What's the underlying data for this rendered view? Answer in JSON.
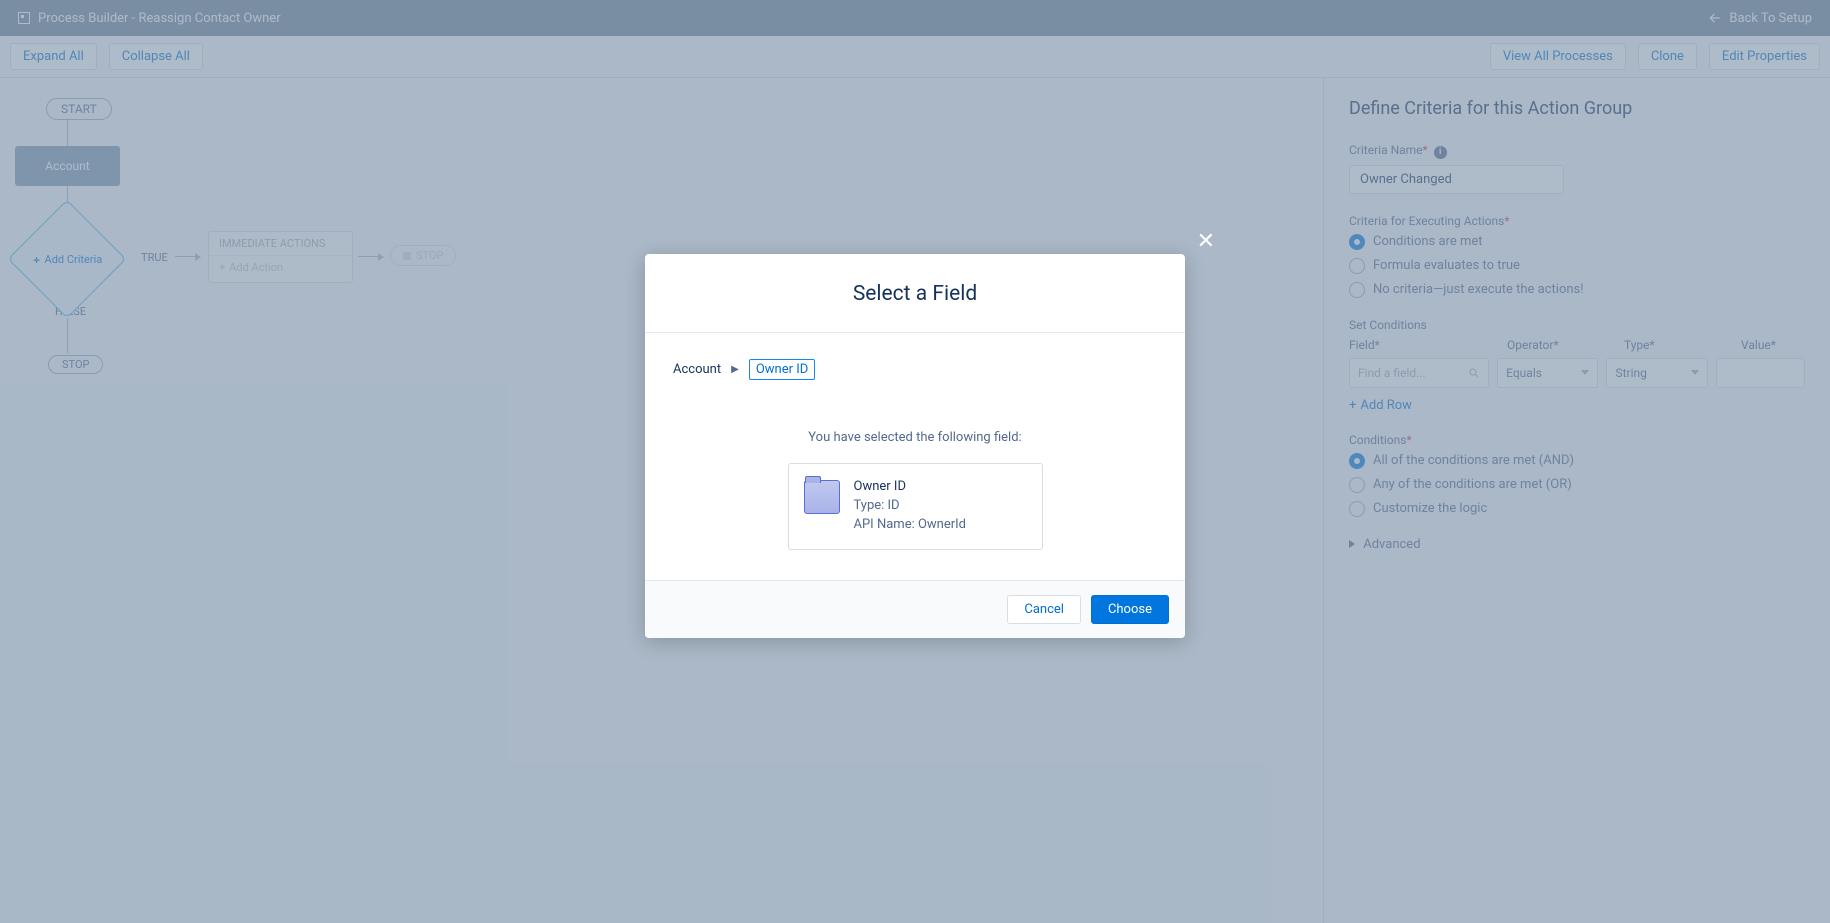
{
  "topbar": {
    "title": "Process Builder - Reassign Contact Owner",
    "back": "Back To Setup"
  },
  "toolbar": {
    "expand": "Expand All",
    "collapse": "Collapse All",
    "view_all": "View All Processes",
    "clone": "Clone",
    "edit_props": "Edit Properties"
  },
  "canvas": {
    "start": "START",
    "object_node": "Account",
    "add_criteria": "Add Criteria",
    "true": "TRUE",
    "false": "FALSE",
    "immediate": "IMMEDIATE ACTIONS",
    "add_action": "Add Action",
    "stop": "STOP"
  },
  "panel": {
    "title": "Define Criteria for this Action Group",
    "criteria_name_label": "Criteria Name",
    "criteria_name_value": "Owner Changed",
    "exec_label": "Criteria for Executing Actions",
    "radios": {
      "r1": "Conditions are met",
      "r2": "Formula evaluates to true",
      "r3": "No criteria—just execute the actions!"
    },
    "set_cond": "Set Conditions",
    "cols": {
      "field": "Field",
      "op": "Operator",
      "type": "Type",
      "value": "Value"
    },
    "row": {
      "field_ph": "Find a field...",
      "op": "Equals",
      "type": "String"
    },
    "add_row": "Add Row",
    "cond_label": "Conditions",
    "logic": {
      "l1": "All of the conditions are met (AND)",
      "l2": "Any of the conditions are met (OR)",
      "l3": "Customize the logic"
    },
    "advanced": "Advanced"
  },
  "modal": {
    "title": "Select a Field",
    "bc_root": "Account",
    "bc_sel": "Owner ID",
    "msg": "You have selected the following field:",
    "field": {
      "name": "Owner ID",
      "type": "Type: ID",
      "api": "API Name: OwnerId"
    },
    "cancel": "Cancel",
    "choose": "Choose"
  }
}
